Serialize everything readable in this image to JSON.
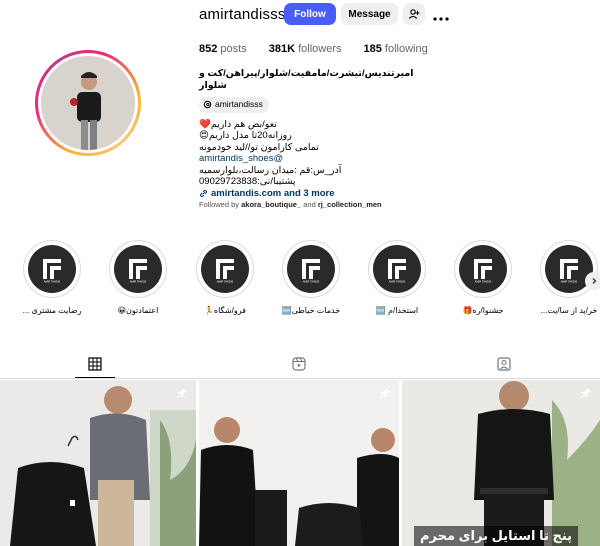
{
  "profile": {
    "username": "amirtandisss",
    "follow_label": "Follow",
    "message_label": "Message",
    "stats": {
      "posts_count": "852",
      "posts_label": "posts",
      "followers_count": "381K",
      "followers_label": "followers",
      "following_count": "185",
      "following_label": "following"
    },
    "bio": {
      "name": "امیرتندیس/تیشرت/مامفیت/شلوار/پیراهن/کت و شلوار",
      "threads_handle": "amirtandisss",
      "line1": "تعو/بض هم داریم❤️",
      "line2": "روزانه20تا مدل داریم😍",
      "line3": "تمامی کارامون تو//لید خودمونه",
      "handle_link": "amirtandis_shoes@",
      "line4": "آدر_س:قم :میدان رسالت،بلوارسمیه",
      "line5": "پشتیبا/نی:09029723838",
      "links": "amirtandis.com and 3 more"
    },
    "followed_by_prefix": "Followed by",
    "followed_by_1": "akora_boutique_",
    "followed_by_and": "and",
    "followed_by_2": "rj_collection_men"
  },
  "highlights": [
    {
      "label": "رضایت مشتری ..."
    },
    {
      "label": "اعتمادتون😀"
    },
    {
      "label": "فرو/شگاه🏃"
    },
    {
      "label": "خدمات خیاطی🆕"
    },
    {
      "label": "استخدا/م 🆕"
    },
    {
      "label": "جشنوا/ره🎁"
    },
    {
      "label": "خر/ید از سا/یت..."
    }
  ],
  "highlight_logo_text": "AMIR TANDIS",
  "posts": [
    {
      "caption": ""
    },
    {
      "caption": ""
    },
    {
      "caption": "پنج تا استایل برای محرم"
    }
  ],
  "colors": {
    "follow_button": "#4a5df9",
    "link": "#00376b",
    "secondary_button": "#efefef"
  },
  "icons": [
    "add-user-icon",
    "more-icon",
    "threads-icon",
    "link-icon",
    "grid-icon",
    "reels-icon",
    "tagged-icon",
    "pin-icon",
    "chevron-right-icon"
  ]
}
